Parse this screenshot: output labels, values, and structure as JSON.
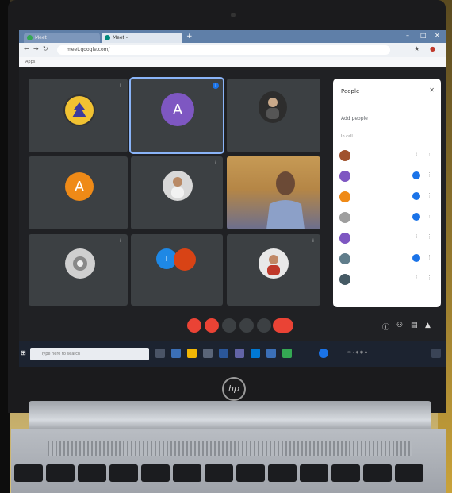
{
  "browser": {
    "tab1_label": "Meet",
    "tab2_label": "Meet - ",
    "address": "meet.google.com/",
    "bookmarks": "Apps"
  },
  "meet": {
    "tiles": [
      {
        "name": "",
        "initial": "",
        "mic": ""
      },
      {
        "name": "",
        "initial": "A",
        "mic": ""
      },
      {
        "name": "",
        "initial": "",
        "mic": ""
      },
      {
        "name": "",
        "initial": "A",
        "mic": ""
      },
      {
        "name": "",
        "initial": "",
        "mic": ""
      },
      {
        "name": "",
        "initial": "",
        "mic": ""
      },
      {
        "name": "",
        "initial": "",
        "mic": ""
      },
      {
        "name": "",
        "initial": "",
        "mic": ""
      },
      {
        "name": "",
        "initial": "",
        "mic": ""
      }
    ],
    "time": "",
    "meeting_code": ""
  },
  "people_panel": {
    "title": "People",
    "add_people": "Add people",
    "section": "In call",
    "participants": [
      "",
      "",
      "",
      "",
      "",
      "",
      ""
    ]
  },
  "taskbar": {
    "search_placeholder": "Type here to search",
    "clock": ""
  },
  "laptop": {
    "brand": "hp"
  },
  "colors": {
    "meet_bg": "#202124",
    "tile_bg": "#3c4043",
    "avatar_purple": "#7e57c2",
    "avatar_orange": "#ef8a17",
    "end_call_red": "#ea4335",
    "active_outline": "#8ab4f8"
  }
}
